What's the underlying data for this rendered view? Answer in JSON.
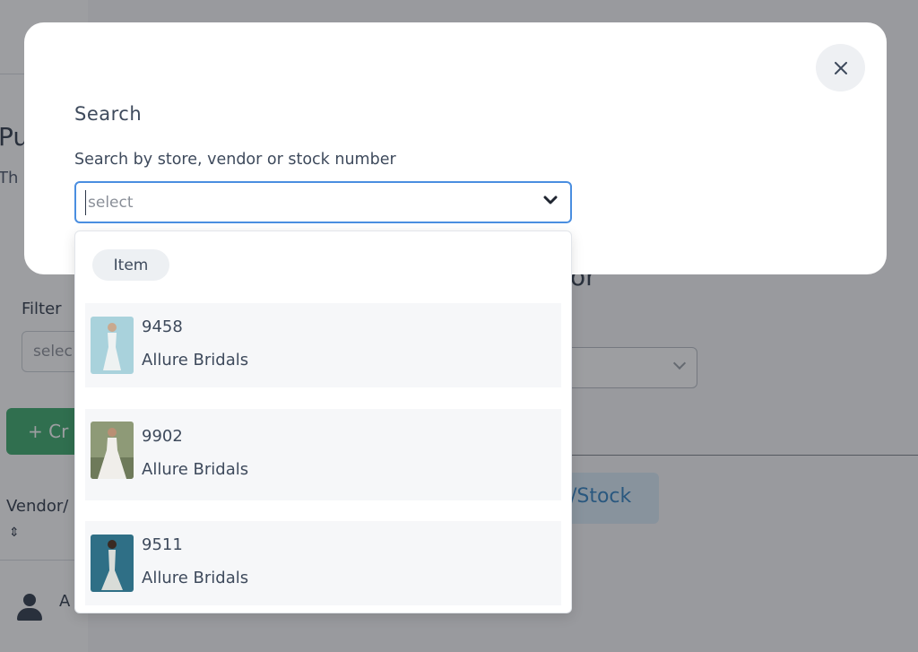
{
  "background": {
    "page_title_fragment": "Pu",
    "page_subtitle_fragment": "Th",
    "filter_label_fragment": "Filter",
    "filter_select_fragment": "selec",
    "create_button_fragment": "+ Cr",
    "vendor_column_fragment": "Vendor/",
    "user_initial_fragment": "A",
    "right_heading_fragment": "or",
    "stock_button_fragment": "n/Stock"
  },
  "modal": {
    "title": "Search",
    "field_label": "Search by store, vendor or stock number",
    "select_placeholder": "select",
    "close_icon": "close-icon",
    "chevron_icon": "chevron-down-icon"
  },
  "dropdown": {
    "group_label": "Item",
    "options": [
      {
        "stock": "9458",
        "vendor": "Allure Bridals",
        "thumb_colors": [
          "#9fc9d6",
          "#d8e6ea"
        ]
      },
      {
        "stock": "9902",
        "vendor": "Allure Bridals",
        "thumb_colors": [
          "#7f8f6a",
          "#e8e6e0"
        ]
      },
      {
        "stock": "9511",
        "vendor": "Allure Bridals",
        "thumb_colors": [
          "#2f6f86",
          "#cfd4d2"
        ]
      }
    ]
  },
  "colors": {
    "accent_border": "#4a8ee0",
    "overlay": "rgba(38,40,46,0.45)",
    "option_bg": "#f6f7f9",
    "text": "#3e4a5c"
  }
}
